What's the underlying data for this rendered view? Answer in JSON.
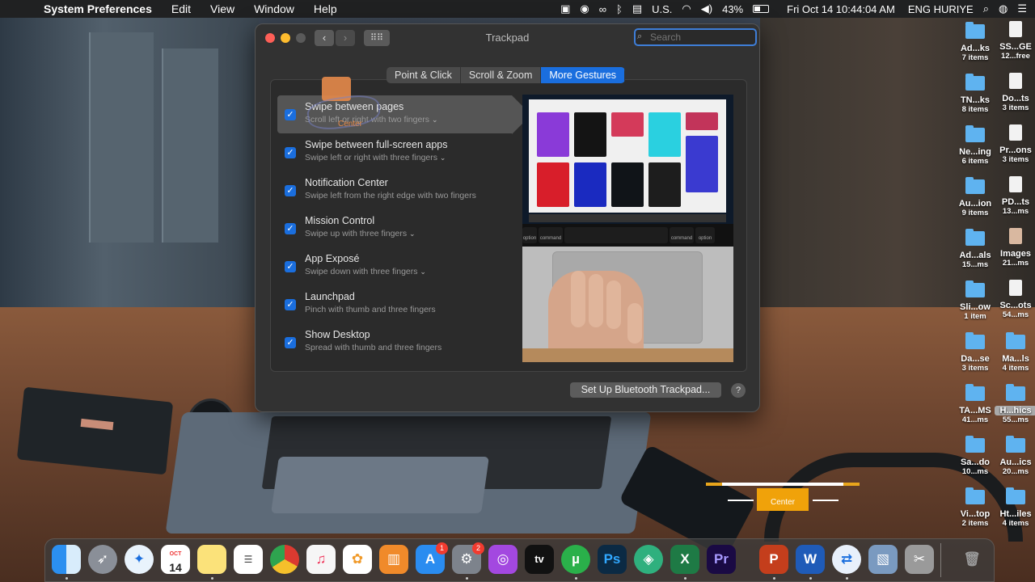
{
  "menubar": {
    "apple": "",
    "app_name": "System Preferences",
    "menus": [
      "Edit",
      "View",
      "Window",
      "Help"
    ],
    "input_source": "U.S.",
    "battery": "43%",
    "datetime": "Fri Oct 14  10:44:04 AM",
    "user": "ENG HURIYE"
  },
  "window": {
    "title": "Trackpad",
    "search_placeholder": "Search",
    "tabs": [
      {
        "label": "Point & Click",
        "active": false
      },
      {
        "label": "Scroll & Zoom",
        "active": false
      },
      {
        "label": "More Gestures",
        "active": true
      }
    ],
    "gestures": [
      {
        "title": "Swipe between pages",
        "subtitle": "Scroll left or right with two fingers",
        "has_menu": true,
        "checked": true,
        "selected": true
      },
      {
        "title": "Swipe between full-screen apps",
        "subtitle": "Swipe left or right with three fingers",
        "has_menu": true,
        "checked": true,
        "selected": false
      },
      {
        "title": "Notification Center",
        "subtitle": "Swipe left from the right edge with two fingers",
        "has_menu": false,
        "checked": true,
        "selected": false
      },
      {
        "title": "Mission Control",
        "subtitle": "Swipe up with three fingers",
        "has_menu": true,
        "checked": true,
        "selected": false
      },
      {
        "title": "App Exposé",
        "subtitle": "Swipe down with three fingers",
        "has_menu": true,
        "checked": true,
        "selected": false
      },
      {
        "title": "Launchpad",
        "subtitle": "Pinch with thumb and three fingers",
        "has_menu": false,
        "checked": true,
        "selected": false
      },
      {
        "title": "Show Desktop",
        "subtitle": "Spread with thumb and three fingers",
        "has_menu": false,
        "checked": true,
        "selected": false
      }
    ],
    "preview_keys": {
      "option": "option",
      "command": "command"
    },
    "setup_button": "Set Up Bluetooth Trackpad...",
    "help_button": "?"
  },
  "desktop_icons": [
    {
      "name": "Ad...ks",
      "count": "7 items",
      "kind": "folder"
    },
    {
      "name": "SS...GE",
      "count": "12...free",
      "kind": "disk"
    },
    {
      "name": "TN...ks",
      "count": "8 items",
      "kind": "folder"
    },
    {
      "name": "Do...ts",
      "count": "3 items",
      "kind": "doc"
    },
    {
      "name": "Ne...ing",
      "count": "6 items",
      "kind": "folder"
    },
    {
      "name": "Pr...ons",
      "count": "3 items",
      "kind": "doc"
    },
    {
      "name": "Au...ion",
      "count": "9 items",
      "kind": "folder"
    },
    {
      "name": "PD...ts",
      "count": "13...ms",
      "kind": "doc"
    },
    {
      "name": "Ad...als",
      "count": "15...ms",
      "kind": "folder"
    },
    {
      "name": "Images",
      "count": "21...ms",
      "kind": "doc"
    },
    {
      "name": "Sli...ow",
      "count": "1 item",
      "kind": "folder"
    },
    {
      "name": "Sc...ots",
      "count": "54...ms",
      "kind": "doc"
    },
    {
      "name": "Da...se",
      "count": "3 items",
      "kind": "folder"
    },
    {
      "name": "Ma...ls",
      "count": "4 items",
      "kind": "folder"
    },
    {
      "name": "TA...MS",
      "count": "41...ms",
      "kind": "folder"
    },
    {
      "name": "H...hics",
      "count": "55...ms",
      "kind": "folder",
      "highlighted": true
    },
    {
      "name": "Sa...do",
      "count": "10...ms",
      "kind": "folder"
    },
    {
      "name": "Au...ics",
      "count": "20...ms",
      "kind": "folder"
    },
    {
      "name": "Vi...top",
      "count": "2 items",
      "kind": "folder"
    },
    {
      "name": "Ht...iles",
      "count": "4 items",
      "kind": "folder"
    }
  ],
  "watermark": {
    "text": "Center"
  },
  "dock": {
    "calendar_month": "OCT",
    "calendar_day": "14",
    "appstore_badge": "1",
    "sysprefs_badge": "2",
    "tv_label": "tv",
    "ps_label": "Ps",
    "pr_label": "Pr",
    "w_label": "W",
    "x_label": "X",
    "p_label": "P",
    "apps": [
      "Finder",
      "Launchpad",
      "Safari",
      "Calendar",
      "Notes",
      "Reminders",
      "Chrome",
      "Music",
      "Photos",
      "Books",
      "App Store",
      "System Preferences",
      "Podcasts",
      "TV",
      "uTorrent",
      "Photoshop",
      "Surfshark",
      "Excel",
      "Premiere Pro",
      "PowerPoint",
      "Word",
      "TeamViewer",
      "Preview",
      "Screenshot",
      "Trash"
    ]
  },
  "colors": {
    "accent": "#1a6ede",
    "badge": "#f23b2f"
  }
}
